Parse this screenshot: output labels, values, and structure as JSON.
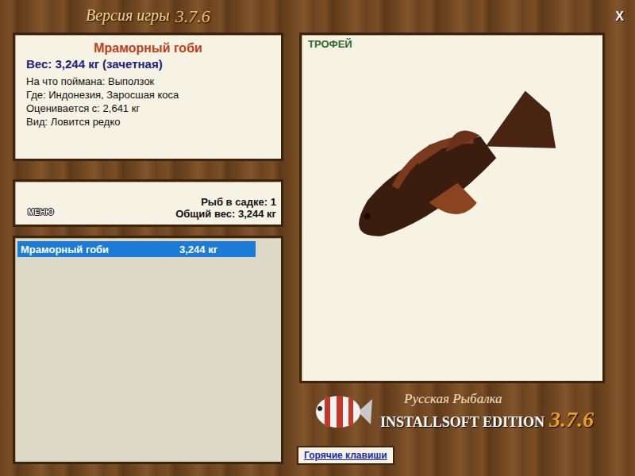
{
  "window": {
    "title": "Версия игры",
    "version": "3.7.6",
    "close": "X"
  },
  "catch": {
    "name": "Мраморный гоби",
    "weight": "Вес: 3,244 кг (зачетная)",
    "details": [
      "На что поймана: Выползок",
      "Где: Индонезия, Заросшая коса",
      "Оценивается с: 2,641 кг",
      "Вид: Ловится редко"
    ]
  },
  "keepnet": {
    "menu": "МЕНЮ",
    "count": "Рыб в садке: 1",
    "total": "Общий вес: 3,244 кг"
  },
  "list": [
    {
      "name": "Мраморный гоби",
      "weight": "3,244 кг",
      "selected": true
    }
  ],
  "trophy": {
    "badge": "ТРОФЕЙ"
  },
  "brand": {
    "line1": "Русская Рыбалка",
    "line2": "INSTALLSOFT EDITION",
    "version": "3.7.6"
  },
  "hotkeys": "Горячие клавиши"
}
